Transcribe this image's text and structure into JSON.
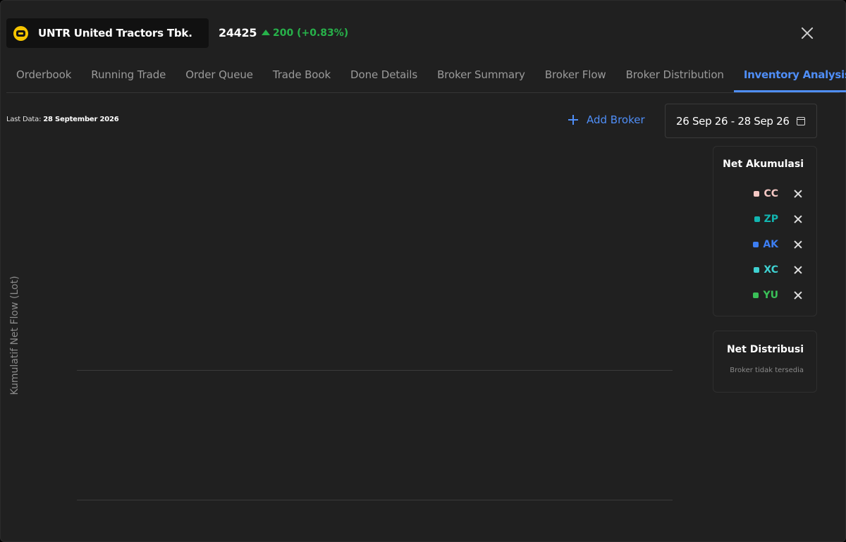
{
  "header": {
    "ticker": "UNTR United Tractors Tbk.",
    "price": "24425",
    "change": "200 (+0.83%)",
    "logo_icon": "company-logo-icon",
    "close_icon": "close-icon"
  },
  "tabs": [
    {
      "label": "Orderbook",
      "active": false
    },
    {
      "label": "Running Trade",
      "active": false
    },
    {
      "label": "Order Queue",
      "active": false
    },
    {
      "label": "Trade Book",
      "active": false
    },
    {
      "label": "Done Details",
      "active": false
    },
    {
      "label": "Broker Summary",
      "active": false
    },
    {
      "label": "Broker Flow",
      "active": false
    },
    {
      "label": "Broker Distribution",
      "active": false
    },
    {
      "label": "Inventory Analysis",
      "active": true
    }
  ],
  "toolbar": {
    "last_data_label": "Last Data:",
    "last_data_value": "28 September 2026",
    "add_broker_label": "Add Broker",
    "date_range": "26 Sep 26 - 28 Sep 26",
    "calendar_icon": "calendar-icon"
  },
  "chart": {
    "y_label": "Kumulatif Net Flow (Lot)"
  },
  "net_akumulasi": {
    "title": "Net Akumulasi",
    "brokers": [
      {
        "code": "CC",
        "color": "#f4c7c3"
      },
      {
        "code": "ZP",
        "color": "#12b5b0"
      },
      {
        "code": "AK",
        "color": "#3d7ef2"
      },
      {
        "code": "XC",
        "color": "#3fd1d1"
      },
      {
        "code": "YU",
        "color": "#3ac058"
      }
    ]
  },
  "net_distribusi": {
    "title": "Net Distribusi",
    "empty_text": "Broker tidak tersedia"
  },
  "colors": {
    "accent": "#4f8ef7",
    "up": "#27b24a",
    "background": "#202020"
  }
}
